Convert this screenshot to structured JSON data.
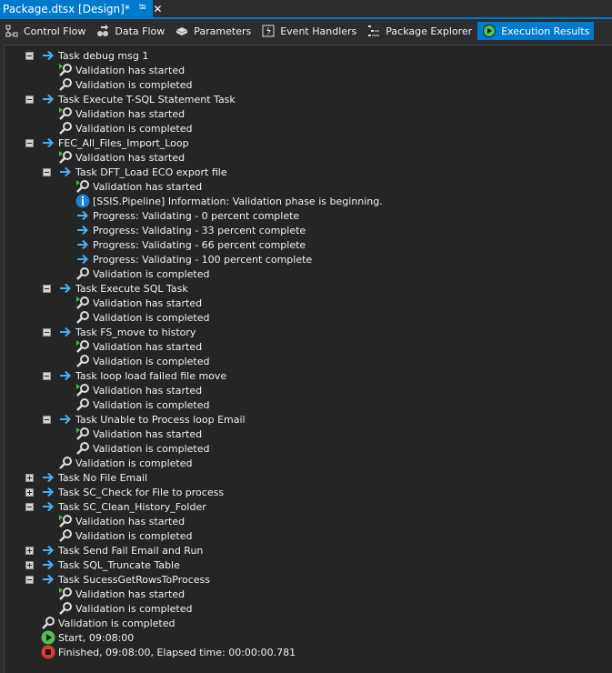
{
  "document_tab": {
    "title": "Package.dtsx [Design]*",
    "pin_icon": "pin-icon",
    "close_icon": "close-icon"
  },
  "toolbar": {
    "items": [
      {
        "label": "Control Flow",
        "icon": "control-flow-icon",
        "active": false
      },
      {
        "label": "Data Flow",
        "icon": "data-flow-icon",
        "active": false
      },
      {
        "label": "Parameters",
        "icon": "parameters-icon",
        "active": false
      },
      {
        "label": "Event Handlers",
        "icon": "event-handlers-icon",
        "active": false
      },
      {
        "label": "Package Explorer",
        "icon": "package-explorer-icon",
        "active": false
      },
      {
        "label": "Execution Results",
        "icon": "execution-results-icon",
        "active": true
      }
    ]
  },
  "colors": {
    "accent": "#007acc",
    "arrow": "#4aaef0",
    "start_green": "#4fc34f",
    "finish_red": "#e03a3a",
    "info_blue": "#1e7fd6"
  },
  "results": [
    {
      "level": 1,
      "expander": "minus",
      "icon": "arrow",
      "text": "Task debug msg 1"
    },
    {
      "level": 2,
      "icon": "validation-start",
      "text": "Validation has started"
    },
    {
      "level": 2,
      "icon": "validation-done",
      "text": "Validation is completed"
    },
    {
      "level": 1,
      "expander": "minus",
      "icon": "arrow",
      "text": "Task Execute T-SQL Statement Task"
    },
    {
      "level": 2,
      "icon": "validation-start",
      "text": "Validation has started"
    },
    {
      "level": 2,
      "icon": "validation-done",
      "text": "Validation is completed"
    },
    {
      "level": 1,
      "expander": "minus",
      "icon": "arrow",
      "text": "FEC_All_Files_Import_Loop"
    },
    {
      "level": 2,
      "icon": "validation-start",
      "text": "Validation has started"
    },
    {
      "level": 2,
      "expander": "minus",
      "icon": "arrow",
      "text": "Task DFT_Load ECO export file"
    },
    {
      "level": 3,
      "icon": "validation-start",
      "text": "Validation has started"
    },
    {
      "level": 3,
      "icon": "info",
      "text": "[SSIS.Pipeline] Information: Validation phase is beginning."
    },
    {
      "level": 3,
      "icon": "arrow",
      "text": "Progress: Validating - 0 percent complete"
    },
    {
      "level": 3,
      "icon": "arrow",
      "text": "Progress: Validating - 33 percent complete"
    },
    {
      "level": 3,
      "icon": "arrow",
      "text": "Progress: Validating - 66 percent complete"
    },
    {
      "level": 3,
      "icon": "arrow",
      "text": "Progress: Validating - 100 percent complete"
    },
    {
      "level": 3,
      "icon": "validation-done",
      "text": "Validation is completed"
    },
    {
      "level": 2,
      "expander": "minus",
      "icon": "arrow",
      "text": "Task Execute SQL Task"
    },
    {
      "level": 3,
      "icon": "validation-start",
      "text": "Validation has started"
    },
    {
      "level": 3,
      "icon": "validation-done",
      "text": "Validation is completed"
    },
    {
      "level": 2,
      "expander": "minus",
      "icon": "arrow",
      "text": "Task FS_move to history"
    },
    {
      "level": 3,
      "icon": "validation-start",
      "text": "Validation has started"
    },
    {
      "level": 3,
      "icon": "validation-done",
      "text": "Validation is completed"
    },
    {
      "level": 2,
      "expander": "minus",
      "icon": "arrow",
      "text": "Task loop load failed file move"
    },
    {
      "level": 3,
      "icon": "validation-start",
      "text": "Validation has started"
    },
    {
      "level": 3,
      "icon": "validation-done",
      "text": "Validation is completed"
    },
    {
      "level": 2,
      "expander": "minus",
      "icon": "arrow",
      "text": "Task Unable to Process loop Email"
    },
    {
      "level": 3,
      "icon": "validation-start",
      "text": "Validation has started"
    },
    {
      "level": 3,
      "icon": "validation-done",
      "text": "Validation is completed"
    },
    {
      "level": 2,
      "icon": "validation-done",
      "text": "Validation is completed"
    },
    {
      "level": 1,
      "expander": "plus",
      "icon": "arrow",
      "text": "Task No File Email"
    },
    {
      "level": 1,
      "expander": "plus",
      "icon": "arrow",
      "text": "Task SC_Check for File to process"
    },
    {
      "level": 1,
      "expander": "minus",
      "icon": "arrow",
      "text": "Task SC_Clean_History_Folder"
    },
    {
      "level": 2,
      "icon": "validation-start",
      "text": "Validation has started"
    },
    {
      "level": 2,
      "icon": "validation-done",
      "text": "Validation is completed"
    },
    {
      "level": 1,
      "expander": "plus",
      "icon": "arrow",
      "text": "Task Send Fail Email and Run"
    },
    {
      "level": 1,
      "expander": "plus",
      "icon": "arrow",
      "text": "Task SQL_Truncate Table"
    },
    {
      "level": 1,
      "expander": "minus",
      "icon": "arrow",
      "text": "Task SucessGetRowsToProcess"
    },
    {
      "level": 2,
      "icon": "validation-start",
      "text": "Validation has started"
    },
    {
      "level": 2,
      "icon": "validation-done",
      "text": "Validation is completed"
    },
    {
      "level": 1,
      "icon": "validation-done",
      "text": "Validation is completed"
    },
    {
      "level": 1,
      "icon": "start",
      "text": "Start, 09:08:00"
    },
    {
      "level": 1,
      "icon": "finish",
      "text": "Finished, 09:08:00, Elapsed time: 00:00:00.781"
    }
  ]
}
